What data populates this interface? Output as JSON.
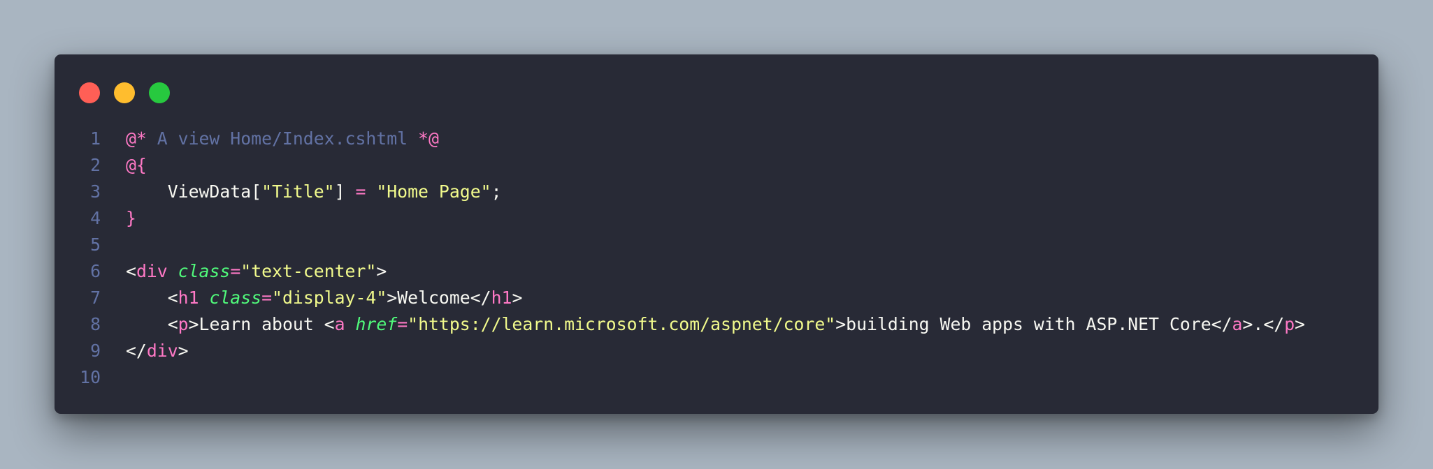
{
  "colors": {
    "background": "#a9b5c1",
    "editor": "#282a36",
    "close": "#ff5f56",
    "minimize": "#ffbd2e",
    "maximize": "#27c93f",
    "line_numbers": "#6272a4",
    "comment": "#6272a4",
    "keyword": "#ff79c6",
    "string": "#f1fa8c",
    "attribute": "#50fa7b",
    "text": "#f8f8f2"
  },
  "code": {
    "lines": [
      {
        "n": "1",
        "tokens": [
          [
            "c-pink",
            "@*"
          ],
          [
            "c-comment",
            " A view Home/Index.cshtml "
          ],
          [
            "c-pink",
            "*@"
          ]
        ]
      },
      {
        "n": "2",
        "tokens": [
          [
            "c-pink",
            "@{"
          ]
        ]
      },
      {
        "n": "3",
        "tokens": [
          [
            "c-plain",
            "    ViewData["
          ],
          [
            "c-str",
            "\"Title\""
          ],
          [
            "c-plain",
            "] "
          ],
          [
            "c-pink",
            "="
          ],
          [
            "c-plain",
            " "
          ],
          [
            "c-str",
            "\"Home Page\""
          ],
          [
            "c-plain",
            ";"
          ]
        ]
      },
      {
        "n": "4",
        "tokens": [
          [
            "c-pink",
            "}"
          ]
        ]
      },
      {
        "n": "5",
        "tokens": []
      },
      {
        "n": "6",
        "tokens": [
          [
            "c-plain",
            "<"
          ],
          [
            "c-pink",
            "div"
          ],
          [
            "c-plain",
            " "
          ],
          [
            "c-attr",
            "class"
          ],
          [
            "c-pink",
            "="
          ],
          [
            "c-str",
            "\"text-center\""
          ],
          [
            "c-plain",
            ">"
          ]
        ]
      },
      {
        "n": "7",
        "tokens": [
          [
            "c-plain",
            "    <"
          ],
          [
            "c-pink",
            "h1"
          ],
          [
            "c-plain",
            " "
          ],
          [
            "c-attr",
            "class"
          ],
          [
            "c-pink",
            "="
          ],
          [
            "c-str",
            "\"display-4\""
          ],
          [
            "c-plain",
            ">Welcome</"
          ],
          [
            "c-pink",
            "h1"
          ],
          [
            "c-plain",
            ">"
          ]
        ]
      },
      {
        "n": "8",
        "tokens": [
          [
            "c-plain",
            "    <"
          ],
          [
            "c-pink",
            "p"
          ],
          [
            "c-plain",
            ">Learn about <"
          ],
          [
            "c-pink",
            "a"
          ],
          [
            "c-plain",
            " "
          ],
          [
            "c-attr",
            "href"
          ],
          [
            "c-pink",
            "="
          ],
          [
            "c-str",
            "\"https://learn.microsoft.com/aspnet/core\""
          ],
          [
            "c-plain",
            ">building Web apps with ASP.NET Core</"
          ],
          [
            "c-pink",
            "a"
          ],
          [
            "c-plain",
            ">.</"
          ],
          [
            "c-pink",
            "p"
          ],
          [
            "c-plain",
            ">"
          ]
        ]
      },
      {
        "n": "9",
        "tokens": [
          [
            "c-plain",
            "</"
          ],
          [
            "c-pink",
            "div"
          ],
          [
            "c-plain",
            ">"
          ]
        ]
      },
      {
        "n": "10",
        "tokens": []
      }
    ]
  }
}
